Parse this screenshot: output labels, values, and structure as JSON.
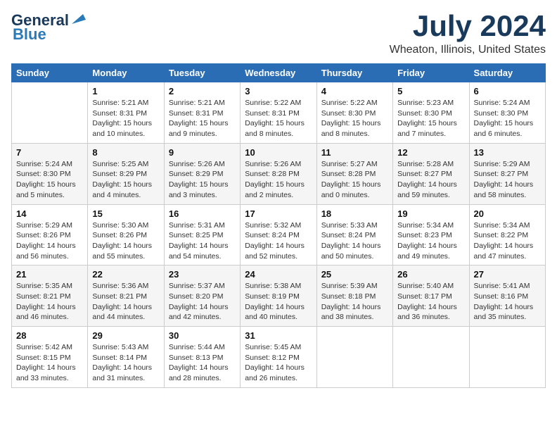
{
  "header": {
    "logo_line1": "General",
    "logo_line2": "Blue",
    "month": "July 2024",
    "location": "Wheaton, Illinois, United States"
  },
  "days_of_week": [
    "Sunday",
    "Monday",
    "Tuesday",
    "Wednesday",
    "Thursday",
    "Friday",
    "Saturday"
  ],
  "weeks": [
    [
      {
        "num": "",
        "info": ""
      },
      {
        "num": "1",
        "info": "Sunrise: 5:21 AM\nSunset: 8:31 PM\nDaylight: 15 hours\nand 10 minutes."
      },
      {
        "num": "2",
        "info": "Sunrise: 5:21 AM\nSunset: 8:31 PM\nDaylight: 15 hours\nand 9 minutes."
      },
      {
        "num": "3",
        "info": "Sunrise: 5:22 AM\nSunset: 8:31 PM\nDaylight: 15 hours\nand 8 minutes."
      },
      {
        "num": "4",
        "info": "Sunrise: 5:22 AM\nSunset: 8:30 PM\nDaylight: 15 hours\nand 8 minutes."
      },
      {
        "num": "5",
        "info": "Sunrise: 5:23 AM\nSunset: 8:30 PM\nDaylight: 15 hours\nand 7 minutes."
      },
      {
        "num": "6",
        "info": "Sunrise: 5:24 AM\nSunset: 8:30 PM\nDaylight: 15 hours\nand 6 minutes."
      }
    ],
    [
      {
        "num": "7",
        "info": "Sunrise: 5:24 AM\nSunset: 8:30 PM\nDaylight: 15 hours\nand 5 minutes."
      },
      {
        "num": "8",
        "info": "Sunrise: 5:25 AM\nSunset: 8:29 PM\nDaylight: 15 hours\nand 4 minutes."
      },
      {
        "num": "9",
        "info": "Sunrise: 5:26 AM\nSunset: 8:29 PM\nDaylight: 15 hours\nand 3 minutes."
      },
      {
        "num": "10",
        "info": "Sunrise: 5:26 AM\nSunset: 8:28 PM\nDaylight: 15 hours\nand 2 minutes."
      },
      {
        "num": "11",
        "info": "Sunrise: 5:27 AM\nSunset: 8:28 PM\nDaylight: 15 hours\nand 0 minutes."
      },
      {
        "num": "12",
        "info": "Sunrise: 5:28 AM\nSunset: 8:27 PM\nDaylight: 14 hours\nand 59 minutes."
      },
      {
        "num": "13",
        "info": "Sunrise: 5:29 AM\nSunset: 8:27 PM\nDaylight: 14 hours\nand 58 minutes."
      }
    ],
    [
      {
        "num": "14",
        "info": "Sunrise: 5:29 AM\nSunset: 8:26 PM\nDaylight: 14 hours\nand 56 minutes."
      },
      {
        "num": "15",
        "info": "Sunrise: 5:30 AM\nSunset: 8:26 PM\nDaylight: 14 hours\nand 55 minutes."
      },
      {
        "num": "16",
        "info": "Sunrise: 5:31 AM\nSunset: 8:25 PM\nDaylight: 14 hours\nand 54 minutes."
      },
      {
        "num": "17",
        "info": "Sunrise: 5:32 AM\nSunset: 8:24 PM\nDaylight: 14 hours\nand 52 minutes."
      },
      {
        "num": "18",
        "info": "Sunrise: 5:33 AM\nSunset: 8:24 PM\nDaylight: 14 hours\nand 50 minutes."
      },
      {
        "num": "19",
        "info": "Sunrise: 5:34 AM\nSunset: 8:23 PM\nDaylight: 14 hours\nand 49 minutes."
      },
      {
        "num": "20",
        "info": "Sunrise: 5:34 AM\nSunset: 8:22 PM\nDaylight: 14 hours\nand 47 minutes."
      }
    ],
    [
      {
        "num": "21",
        "info": "Sunrise: 5:35 AM\nSunset: 8:21 PM\nDaylight: 14 hours\nand 46 minutes."
      },
      {
        "num": "22",
        "info": "Sunrise: 5:36 AM\nSunset: 8:21 PM\nDaylight: 14 hours\nand 44 minutes."
      },
      {
        "num": "23",
        "info": "Sunrise: 5:37 AM\nSunset: 8:20 PM\nDaylight: 14 hours\nand 42 minutes."
      },
      {
        "num": "24",
        "info": "Sunrise: 5:38 AM\nSunset: 8:19 PM\nDaylight: 14 hours\nand 40 minutes."
      },
      {
        "num": "25",
        "info": "Sunrise: 5:39 AM\nSunset: 8:18 PM\nDaylight: 14 hours\nand 38 minutes."
      },
      {
        "num": "26",
        "info": "Sunrise: 5:40 AM\nSunset: 8:17 PM\nDaylight: 14 hours\nand 36 minutes."
      },
      {
        "num": "27",
        "info": "Sunrise: 5:41 AM\nSunset: 8:16 PM\nDaylight: 14 hours\nand 35 minutes."
      }
    ],
    [
      {
        "num": "28",
        "info": "Sunrise: 5:42 AM\nSunset: 8:15 PM\nDaylight: 14 hours\nand 33 minutes."
      },
      {
        "num": "29",
        "info": "Sunrise: 5:43 AM\nSunset: 8:14 PM\nDaylight: 14 hours\nand 31 minutes."
      },
      {
        "num": "30",
        "info": "Sunrise: 5:44 AM\nSunset: 8:13 PM\nDaylight: 14 hours\nand 28 minutes."
      },
      {
        "num": "31",
        "info": "Sunrise: 5:45 AM\nSunset: 8:12 PM\nDaylight: 14 hours\nand 26 minutes."
      },
      {
        "num": "",
        "info": ""
      },
      {
        "num": "",
        "info": ""
      },
      {
        "num": "",
        "info": ""
      }
    ]
  ]
}
